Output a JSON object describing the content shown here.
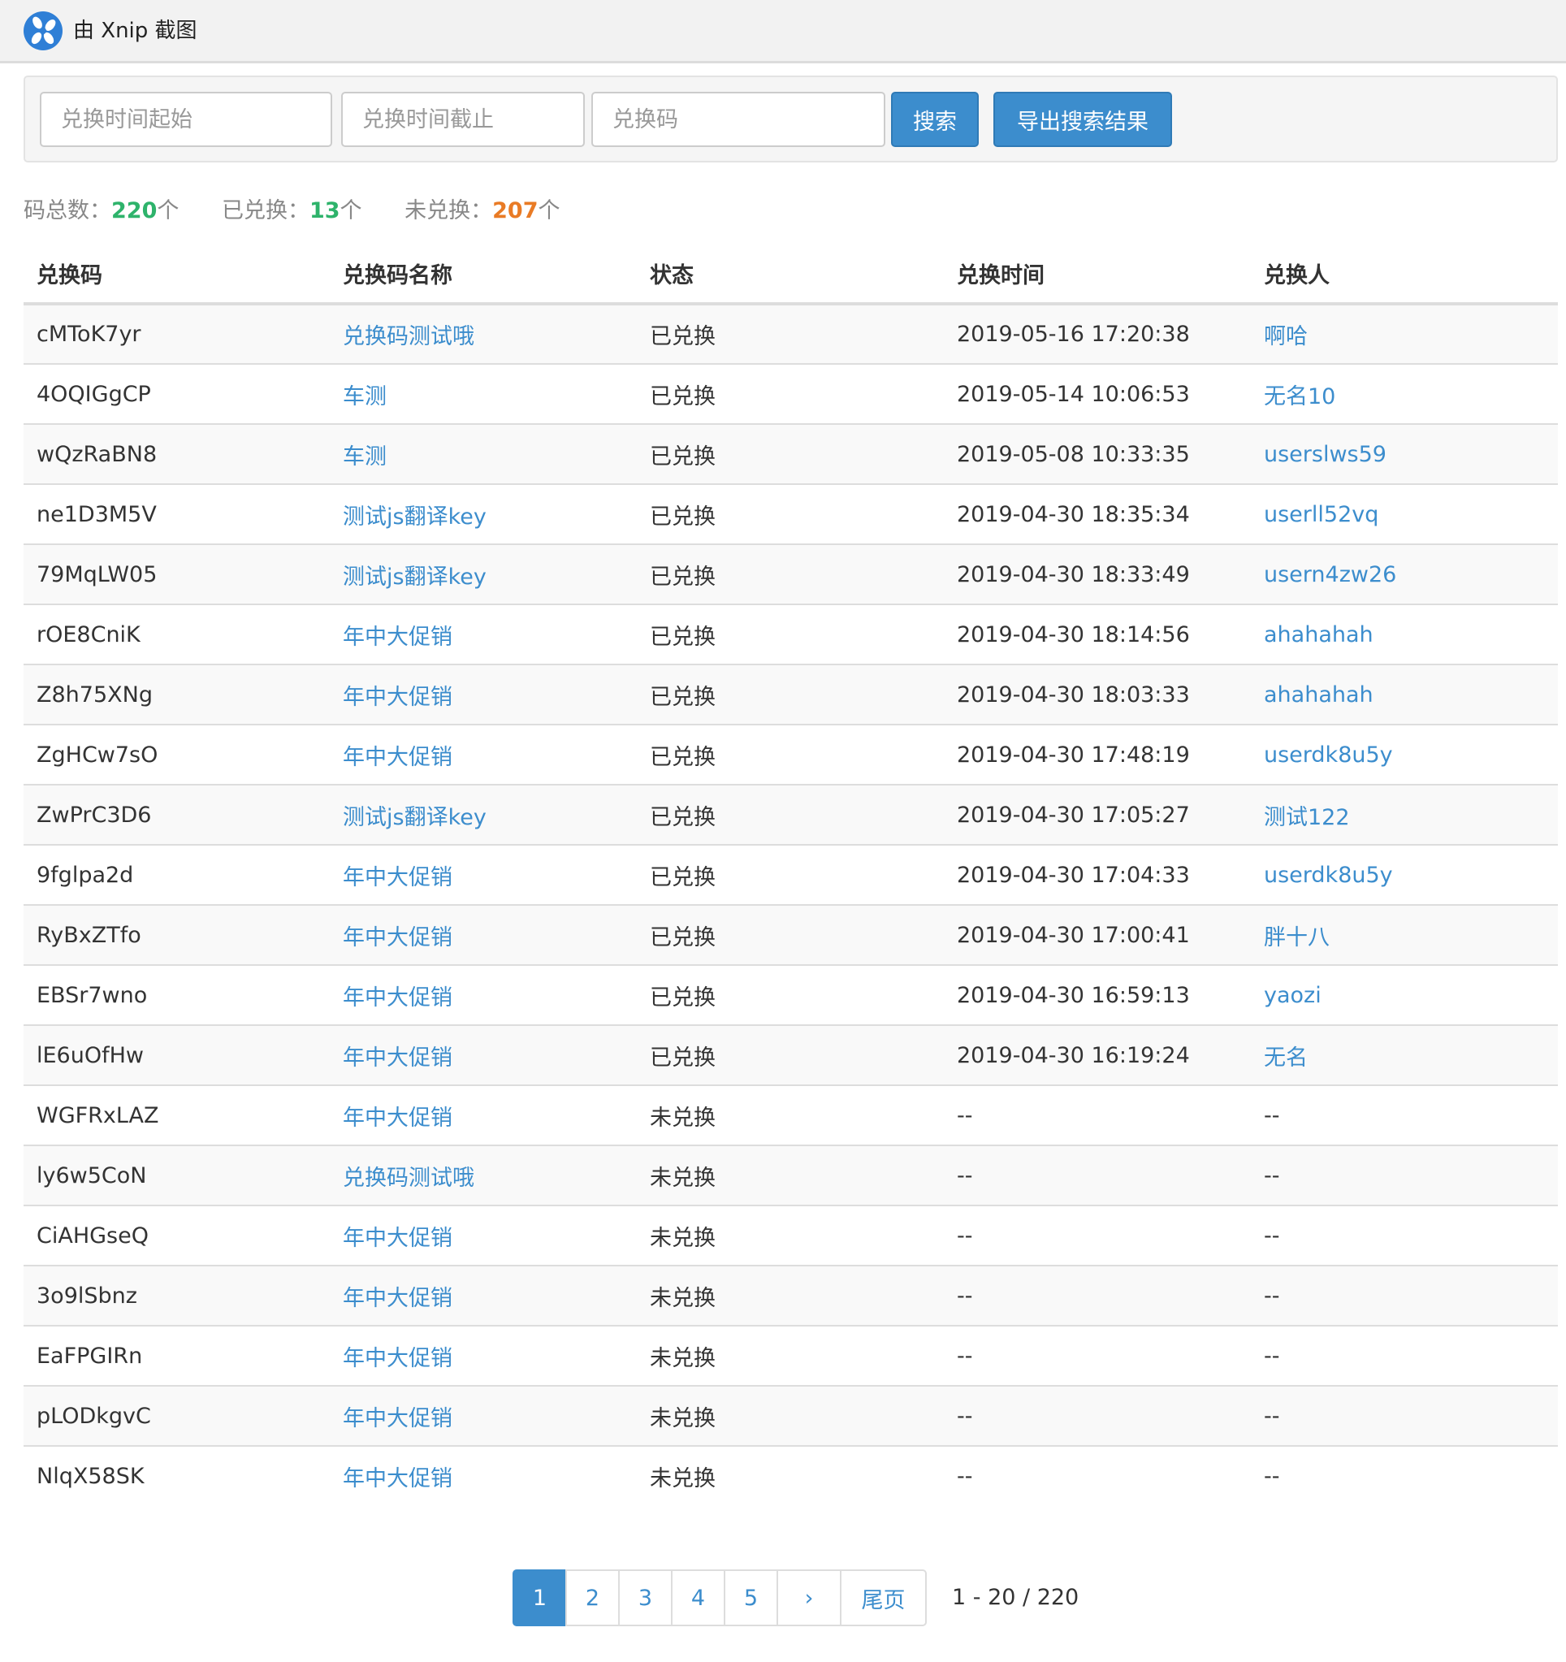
{
  "window": {
    "title": "由 Xnip 截图",
    "logo_icon": "xnip-logo-icon"
  },
  "search": {
    "start_placeholder": "兑换时间起始",
    "end_placeholder": "兑换时间截止",
    "code_placeholder": "兑换码",
    "search_label": "搜索",
    "export_label": "导出搜索结果"
  },
  "summary": {
    "total_label": "码总数：",
    "total_value": "220",
    "redeemed_label": "已兑换：",
    "redeemed_value": "13",
    "unredeemed_label": "未兑换：",
    "unredeemed_value": "207",
    "unit": "个"
  },
  "colors": {
    "accent": "#3c8dcd",
    "green": "#2eb36b",
    "orange": "#e97b25"
  },
  "table": {
    "columns": [
      "兑换码",
      "兑换码名称",
      "状态",
      "兑换时间",
      "兑换人"
    ],
    "rows": [
      {
        "code": "cMToK7yr",
        "name": "兑换码测试哦",
        "status": "已兑换",
        "time": "2019-05-16 17:20:38",
        "user": "啊哈"
      },
      {
        "code": "4OQIGgCP",
        "name": "车测",
        "status": "已兑换",
        "time": "2019-05-14 10:06:53",
        "user": "无名10"
      },
      {
        "code": "wQzRaBN8",
        "name": "车测",
        "status": "已兑换",
        "time": "2019-05-08 10:33:35",
        "user": "userslws59"
      },
      {
        "code": "ne1D3M5V",
        "name": "测试js翻译key",
        "status": "已兑换",
        "time": "2019-04-30 18:35:34",
        "user": "userll52vq"
      },
      {
        "code": "79MqLW05",
        "name": "测试js翻译key",
        "status": "已兑换",
        "time": "2019-04-30 18:33:49",
        "user": "usern4zw26"
      },
      {
        "code": "rOE8CniK",
        "name": "年中大促销",
        "status": "已兑换",
        "time": "2019-04-30 18:14:56",
        "user": "ahahahah"
      },
      {
        "code": "Z8h75XNg",
        "name": "年中大促销",
        "status": "已兑换",
        "time": "2019-04-30 18:03:33",
        "user": "ahahahah"
      },
      {
        "code": "ZgHCw7sO",
        "name": "年中大促销",
        "status": "已兑换",
        "time": "2019-04-30 17:48:19",
        "user": "userdk8u5y"
      },
      {
        "code": "ZwPrC3D6",
        "name": "测试js翻译key",
        "status": "已兑换",
        "time": "2019-04-30 17:05:27",
        "user": "测试122"
      },
      {
        "code": "9fglpa2d",
        "name": "年中大促销",
        "status": "已兑换",
        "time": "2019-04-30 17:04:33",
        "user": "userdk8u5y"
      },
      {
        "code": "RyBxZTfo",
        "name": "年中大促销",
        "status": "已兑换",
        "time": "2019-04-30 17:00:41",
        "user": "胖十八"
      },
      {
        "code": "EBSr7wno",
        "name": "年中大促销",
        "status": "已兑换",
        "time": "2019-04-30 16:59:13",
        "user": "yaozi"
      },
      {
        "code": "lE6uOfHw",
        "name": "年中大促销",
        "status": "已兑换",
        "time": "2019-04-30 16:19:24",
        "user": "无名"
      },
      {
        "code": "WGFRxLAZ",
        "name": "年中大促销",
        "status": "未兑换",
        "time": "--",
        "user": "--"
      },
      {
        "code": "ly6w5CoN",
        "name": "兑换码测试哦",
        "status": "未兑换",
        "time": "--",
        "user": "--"
      },
      {
        "code": "CiAHGseQ",
        "name": "年中大促销",
        "status": "未兑换",
        "time": "--",
        "user": "--"
      },
      {
        "code": "3o9lSbnz",
        "name": "年中大促销",
        "status": "未兑换",
        "time": "--",
        "user": "--"
      },
      {
        "code": "EaFPGIRn",
        "name": "年中大促销",
        "status": "未兑换",
        "time": "--",
        "user": "--"
      },
      {
        "code": "pLODkgvC",
        "name": "年中大促销",
        "status": "未兑换",
        "time": "--",
        "user": "--"
      },
      {
        "code": "NlqX58SK",
        "name": "年中大促销",
        "status": "未兑换",
        "time": "--",
        "user": "--"
      }
    ]
  },
  "pagination": {
    "pages": [
      "1",
      "2",
      "3",
      "4",
      "5"
    ],
    "active_page": "1",
    "next_label": "›",
    "last_label": "尾页",
    "info": "1 - 20 / 220"
  }
}
